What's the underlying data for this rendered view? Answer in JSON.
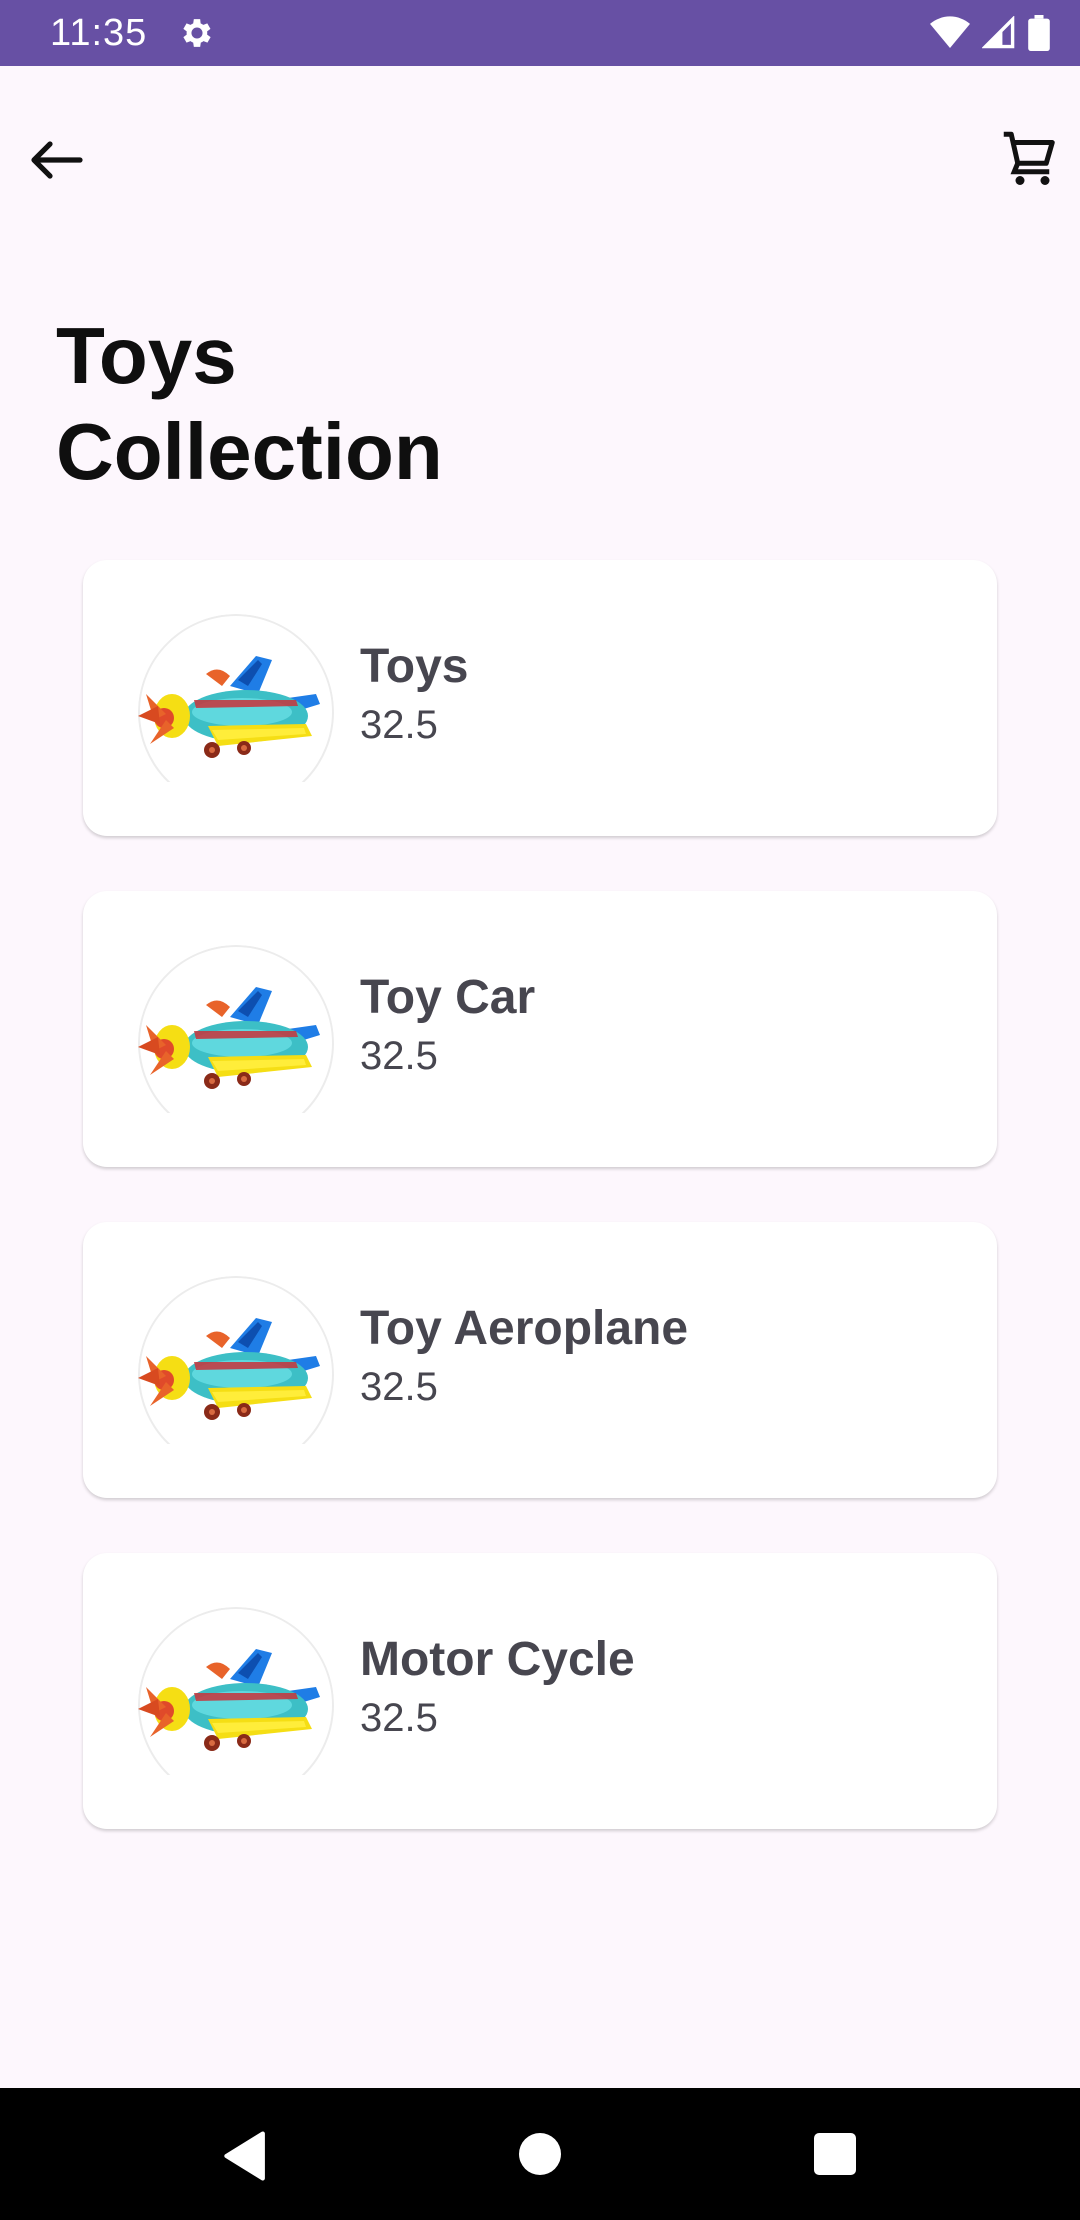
{
  "status_bar": {
    "time": "11:35",
    "color": "#6750a4",
    "icons": [
      "settings-icon",
      "wifi-icon",
      "signal-icon",
      "battery-icon"
    ]
  },
  "top_bar": {
    "back_icon": "arrow-back-icon",
    "cart_icon": "shopping-cart-icon"
  },
  "page": {
    "title_line1": "Toys",
    "title_line2": "Collection"
  },
  "products": [
    {
      "name": "Toys",
      "price": "32.5",
      "image": "toy-aeroplane-image"
    },
    {
      "name": "Toy Car",
      "price": "32.5",
      "image": "toy-aeroplane-image"
    },
    {
      "name": "Toy Aeroplane",
      "price": "32.5",
      "image": "toy-aeroplane-image"
    },
    {
      "name": "Motor Cycle",
      "price": "32.5",
      "image": "toy-aeroplane-image"
    }
  ],
  "nav_bar": {
    "icons": [
      "nav-back-icon",
      "nav-home-icon",
      "nav-recents-icon"
    ]
  },
  "colors": {
    "background": "#fdf7fd",
    "card": "#ffffff",
    "accent": "#6750a4",
    "text_primary": "#0f0f0f",
    "text_secondary": "#47464f"
  }
}
